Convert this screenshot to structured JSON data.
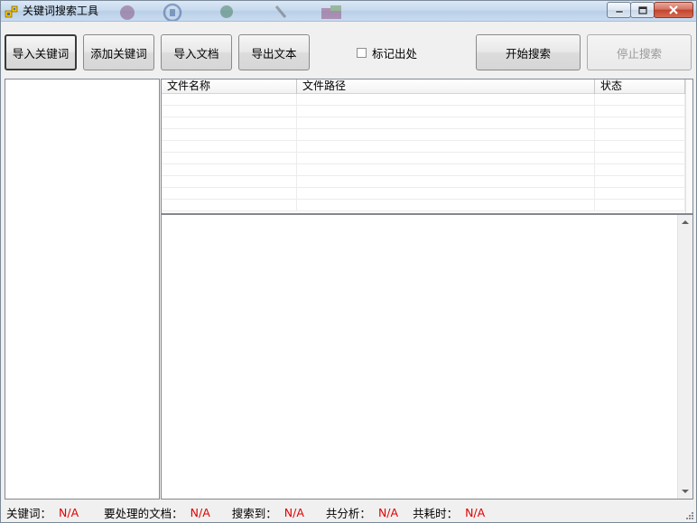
{
  "window": {
    "title": "关键词搜索工具"
  },
  "toolbar": {
    "import_keywords": "导入关键词",
    "add_keyword": "添加关键词",
    "import_documents": "导入文档",
    "export_text": "导出文本",
    "mark_location_label": "标记出处",
    "start_search": "开始搜索",
    "stop_search": "停止搜索"
  },
  "grid": {
    "columns": [
      "文件名称",
      "文件路径",
      "状态"
    ]
  },
  "status": {
    "keywords_label": "关键词：",
    "keywords_value": "N/A",
    "docs_label": "要处理的文档：",
    "docs_value": "N/A",
    "found_label": "搜索到：",
    "found_value": "N/A",
    "analyzed_label": "共分析：",
    "analyzed_value": "N/A",
    "elapsed_label": "共耗时：",
    "elapsed_value": "N/A"
  },
  "colors": {
    "status_value": "#e00000",
    "close_button": "#c4442c"
  }
}
